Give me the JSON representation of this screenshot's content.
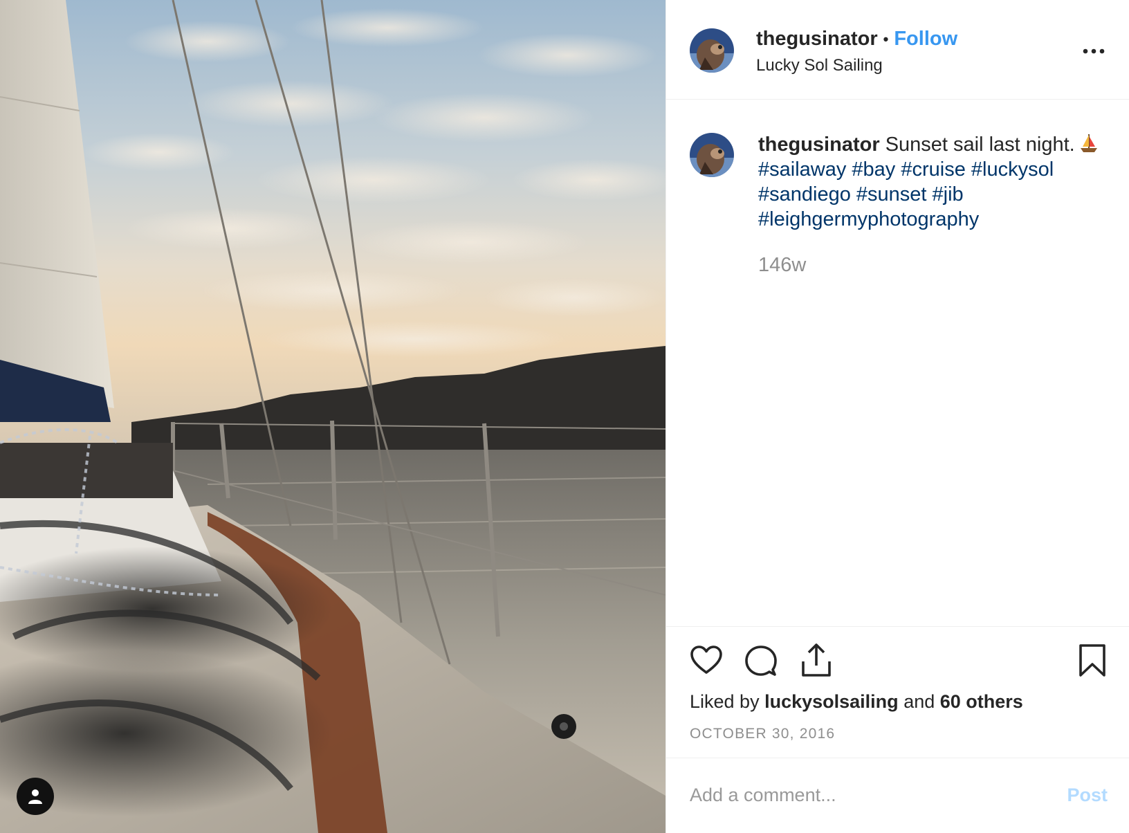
{
  "post": {
    "author": {
      "username": "thegusinator",
      "follow_label": "Follow",
      "separator": "•",
      "location": "Lucky Sol Sailing"
    },
    "caption": {
      "username": "thegusinator",
      "text": "Sunset sail last night.",
      "hashtags": [
        "#sailaway",
        "#bay",
        "#cruise",
        "#luckysol",
        "#sandiego",
        "#sunset",
        "#jib",
        "#leighgermyphotography"
      ],
      "emoji_icon": "sailboat-emoji",
      "time_ago": "146w"
    },
    "engagement": {
      "liked_by_prefix": "Liked by",
      "liked_by_user": "luckysolsailing",
      "and_word": "and",
      "others_label": "60 others",
      "date": "OCTOBER 30, 2016"
    },
    "comment": {
      "placeholder": "Add a comment...",
      "post_label": "Post"
    },
    "icons": {
      "more": "more-options-icon",
      "like": "heart-icon",
      "comment": "comment-bubble-icon",
      "share": "share-icon",
      "save": "bookmark-icon",
      "tag": "user-tag-icon"
    },
    "colors": {
      "link": "#3897f0",
      "hashtag": "#003569",
      "muted": "#8e8e8e",
      "post_disabled": "#b3dbff",
      "text": "#262626"
    }
  }
}
